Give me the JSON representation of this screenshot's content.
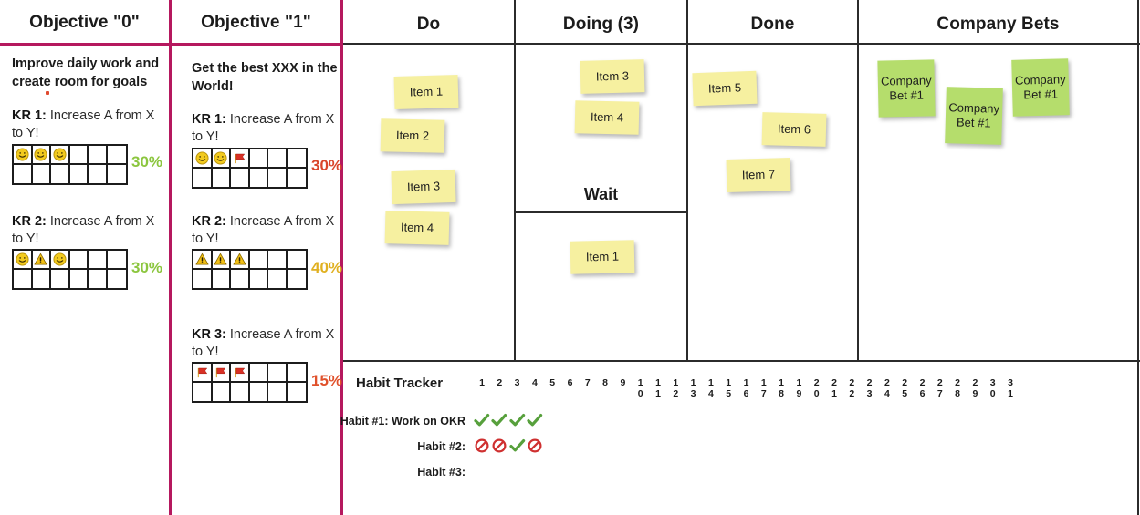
{
  "objectives": [
    {
      "title": "Objective \"0\"",
      "description": "Improve daily work and create room for goals",
      "accent": "#8cc63f",
      "krs": [
        {
          "label": "KR 1:",
          "text": "Increase A from X to Y!",
          "percent": "30%",
          "percent_color": "#8cc63f",
          "cells": [
            "smiley",
            "smiley",
            "smiley",
            "",
            "",
            "",
            "",
            "",
            "",
            "",
            "",
            ""
          ]
        },
        {
          "label": "KR 2:",
          "text": "Increase A from X to Y!",
          "percent": "30%",
          "percent_color": "#8cc63f",
          "cells": [
            "smiley",
            "warning",
            "smiley",
            "",
            "",
            "",
            "",
            "",
            "",
            "",
            "",
            ""
          ]
        }
      ]
    },
    {
      "title": "Objective \"1\"",
      "description": "Get the best XXX in the World!",
      "accent": "#d94a2b",
      "krs": [
        {
          "label": "KR 1:",
          "text": "Increase A from X to Y!",
          "percent": "30%",
          "percent_color": "#d9452b",
          "cells": [
            "smiley",
            "smiley",
            "flag",
            "",
            "",
            "",
            "",
            "",
            "",
            "",
            "",
            ""
          ]
        },
        {
          "label": "KR 2:",
          "text": "Increase A from X to Y!",
          "percent": "40%",
          "percent_color": "#e0b020",
          "cells": [
            "warning",
            "warning",
            "warning",
            "",
            "",
            "",
            "",
            "",
            "",
            "",
            "",
            ""
          ]
        },
        {
          "label": "KR 3:",
          "text": "Increase A from X to Y!",
          "percent": "15%",
          "percent_color": "#e0512b",
          "cells": [
            "flag",
            "flag",
            "flag",
            "",
            "",
            "",
            "",
            "",
            "",
            "",
            "",
            ""
          ]
        }
      ]
    }
  ],
  "kanban": {
    "columns": [
      {
        "title": "Do",
        "notes": [
          {
            "text": "Item 1"
          },
          {
            "text": "Item 2"
          },
          {
            "text": "Item 3"
          },
          {
            "text": "Item 4"
          }
        ]
      },
      {
        "title": "Doing (3)",
        "sub_title": "Wait",
        "notes": [
          {
            "text": "Item 3"
          },
          {
            "text": "Item 4"
          }
        ],
        "wait_notes": [
          {
            "text": "Item 1"
          }
        ]
      },
      {
        "title": "Done",
        "notes": [
          {
            "text": "Item 5"
          },
          {
            "text": "Item 6"
          },
          {
            "text": "Item 7"
          }
        ]
      },
      {
        "title": "Company Bets",
        "notes": [
          {
            "text": "Company Bet #1"
          },
          {
            "text": "Company Bet #1"
          },
          {
            "text": "Company Bet #1"
          }
        ]
      }
    ]
  },
  "habit_tracker": {
    "title": "Habit Tracker",
    "days": [
      "1",
      "2",
      "3",
      "4",
      "5",
      "6",
      "7",
      "8",
      "9",
      "10",
      "11",
      "12",
      "13",
      "14",
      "15",
      "16",
      "17",
      "18",
      "19",
      "20",
      "21",
      "22",
      "23",
      "24",
      "25",
      "26",
      "27",
      "28",
      "29",
      "30",
      "31"
    ],
    "rows": [
      {
        "label": "Habit #1: Work on OKR",
        "marks": [
          "check",
          "check",
          "check",
          "check"
        ]
      },
      {
        "label": "Habit #2:",
        "marks": [
          "block",
          "block",
          "check",
          "block"
        ]
      },
      {
        "label": "Habit #3:",
        "marks": []
      }
    ]
  },
  "colors": {
    "accent_magenta": "#b5185e",
    "grid_dark": "#2b2b2b",
    "note_yellow": "#f6f0a0",
    "note_green": "#b5dd6c"
  }
}
